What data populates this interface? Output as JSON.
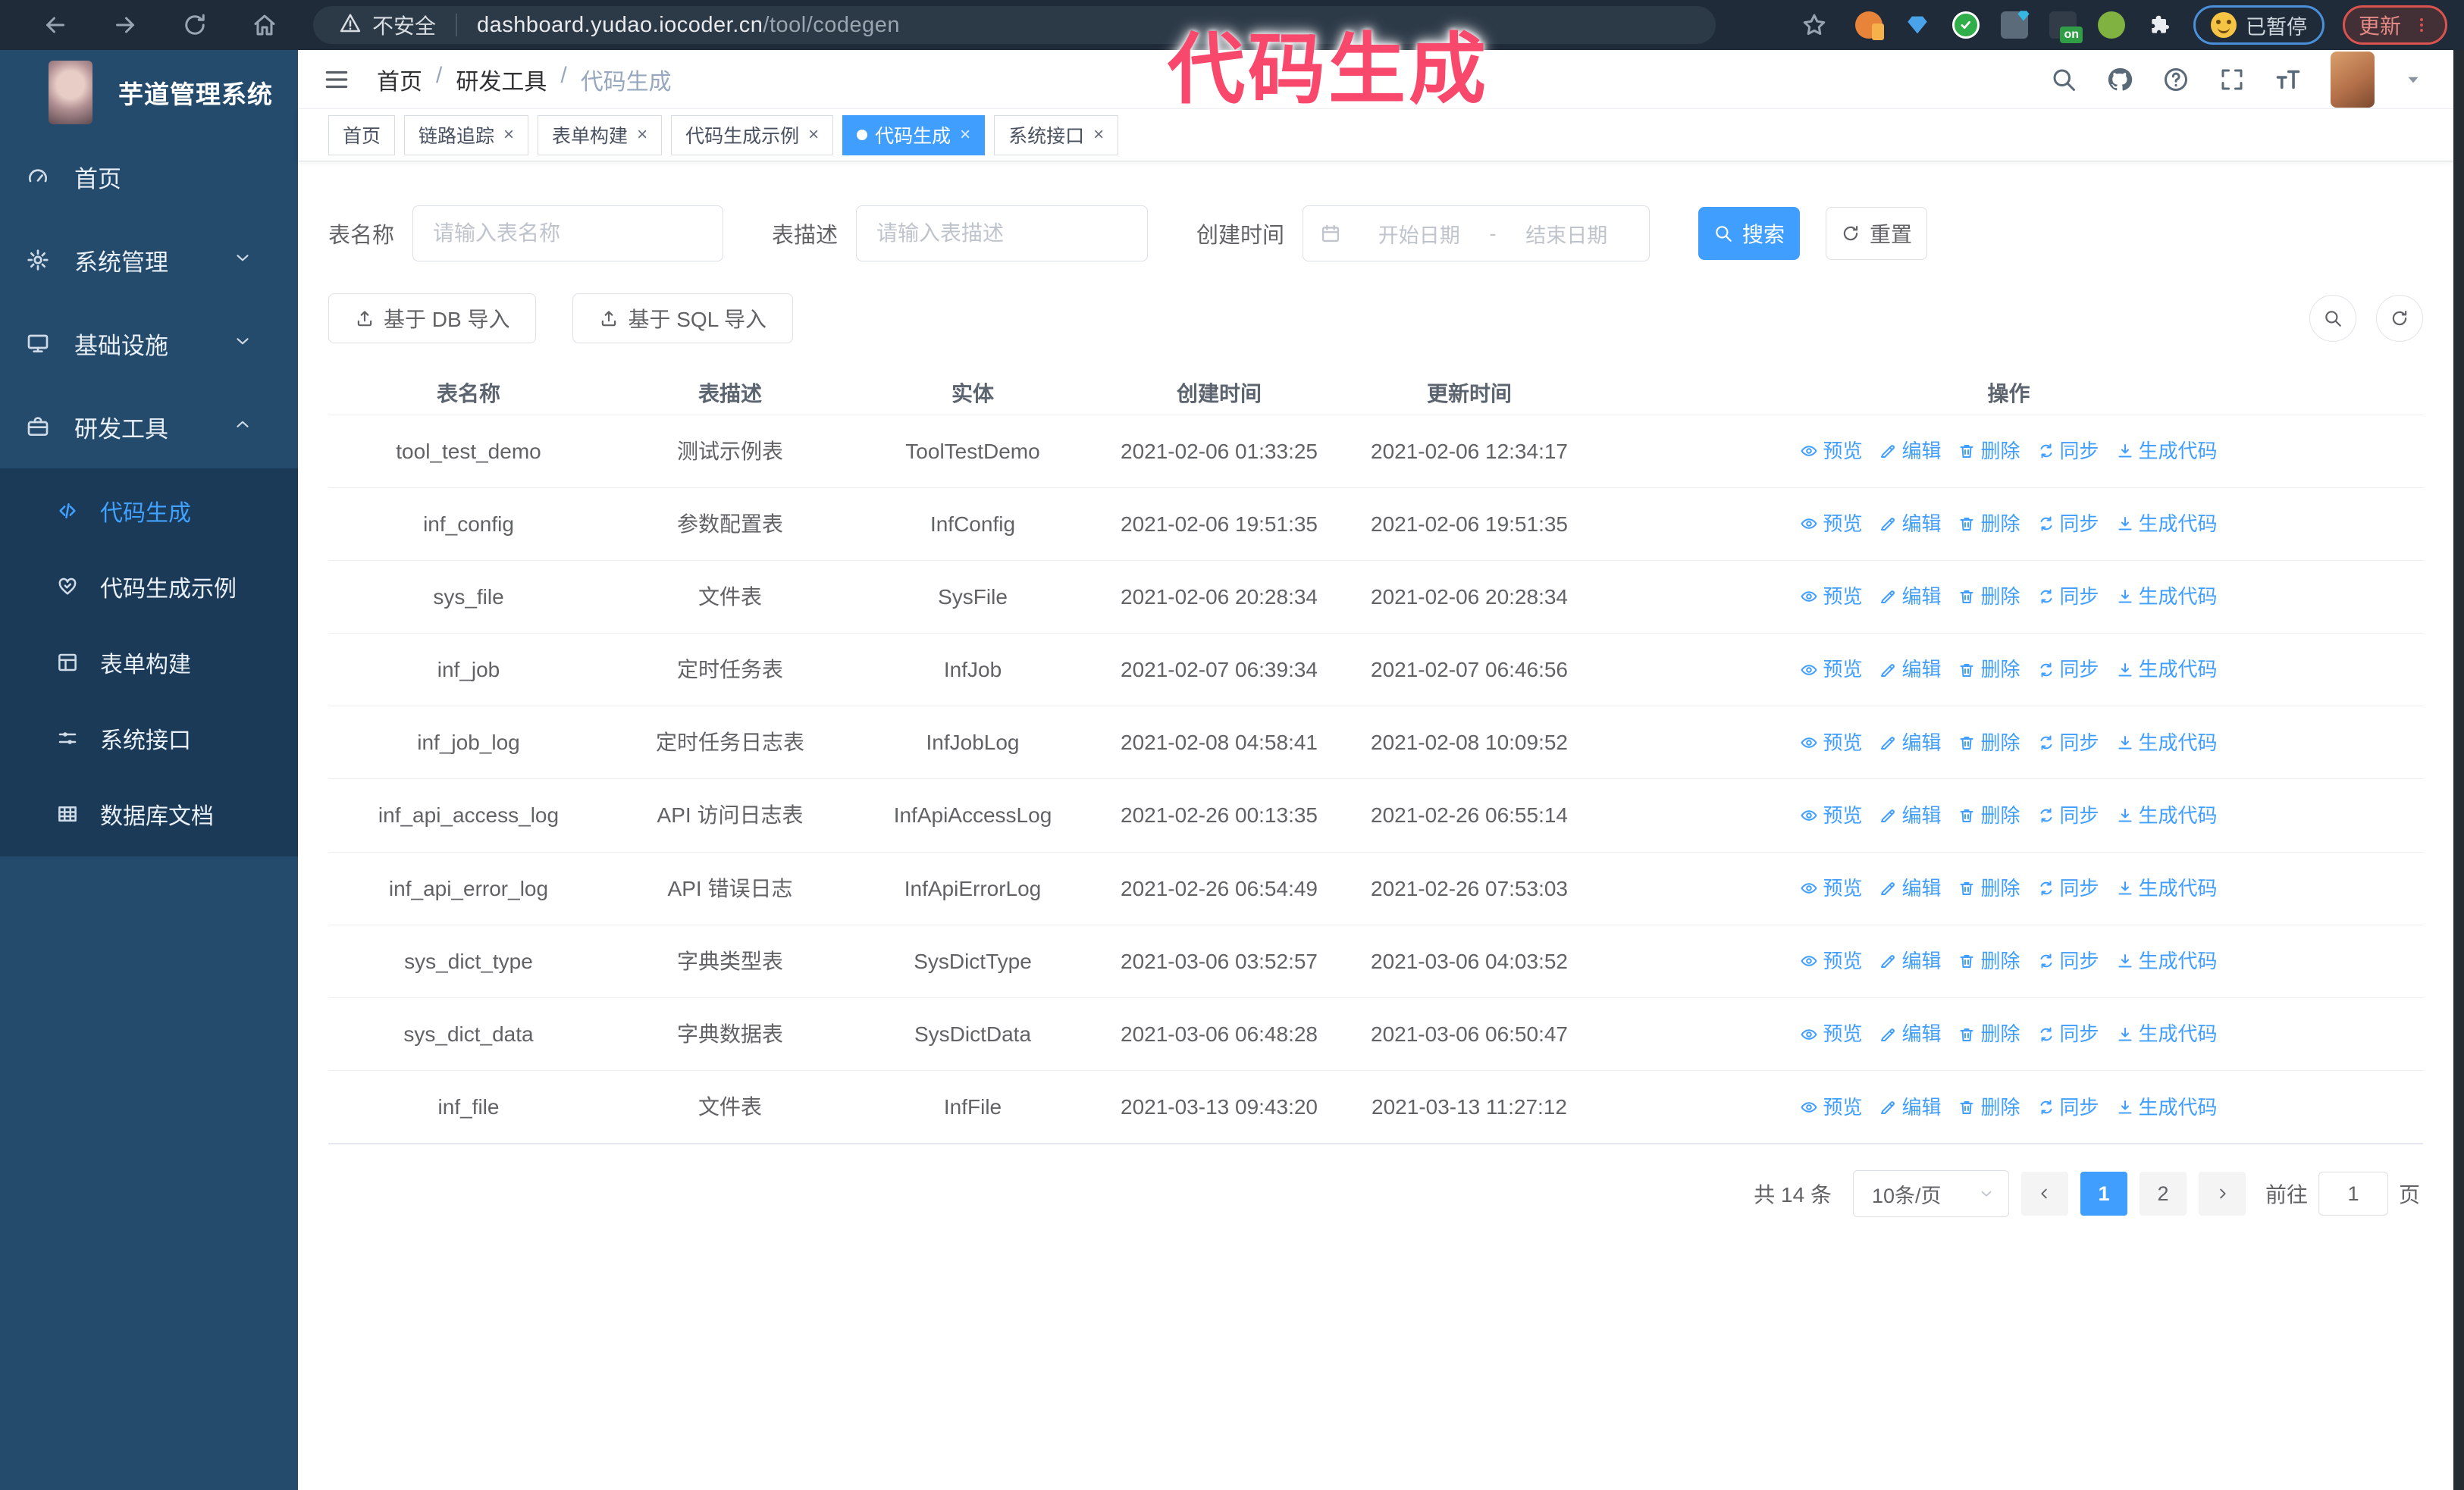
{
  "colors": {
    "accent": "#409eff",
    "overlay_pink": "#f8486c",
    "sidebar_bg": "#244a6c",
    "submenu_bg": "#1b3a58",
    "browser_bar": "#202b39"
  },
  "overlay_text": "代码生成",
  "browser": {
    "security_label": "不安全",
    "url_host": "dashboard.yudao.iocoder.cn",
    "url_path": "/tool/codegen",
    "ext_badge_on": "on",
    "paused_badge": "已暂停",
    "update_label": "更新"
  },
  "sidebar": {
    "logo_title": "芋道管理系统",
    "items": [
      {
        "label": "首页",
        "icon": "dashboard",
        "arrow": ""
      },
      {
        "label": "系统管理",
        "icon": "gear",
        "arrow": "down"
      },
      {
        "label": "基础设施",
        "icon": "monitor",
        "arrow": "down"
      },
      {
        "label": "研发工具",
        "icon": "tool",
        "arrow": "up",
        "open": true
      }
    ],
    "submenu": [
      {
        "label": "代码生成",
        "icon": "code",
        "active": true
      },
      {
        "label": "代码生成示例",
        "icon": "example",
        "active": false
      },
      {
        "label": "表单构建",
        "icon": "form",
        "active": false
      },
      {
        "label": "系统接口",
        "icon": "api",
        "active": false
      },
      {
        "label": "数据库文档",
        "icon": "db",
        "active": false
      }
    ]
  },
  "header": {
    "breadcrumb": [
      "首页",
      "研发工具",
      "代码生成"
    ],
    "separator": "/"
  },
  "tabs": [
    {
      "label": "首页",
      "closable": false,
      "active": false
    },
    {
      "label": "链路追踪",
      "closable": true,
      "active": false
    },
    {
      "label": "表单构建",
      "closable": true,
      "active": false
    },
    {
      "label": "代码生成示例",
      "closable": true,
      "active": false
    },
    {
      "label": "代码生成",
      "closable": true,
      "active": true
    },
    {
      "label": "系统接口",
      "closable": true,
      "active": false
    }
  ],
  "filters": {
    "name_label": "表名称",
    "name_placeholder": "请输入表名称",
    "desc_label": "表描述",
    "desc_placeholder": "请输入表描述",
    "time_label": "创建时间",
    "start_placeholder": "开始日期",
    "range_separator": "-",
    "end_placeholder": "结束日期",
    "search_label": "搜索",
    "reset_label": "重置"
  },
  "toolbar": {
    "import_db_label": "基于 DB 导入",
    "import_sql_label": "基于 SQL 导入"
  },
  "table": {
    "columns": [
      "表名称",
      "表描述",
      "实体",
      "创建时间",
      "更新时间",
      "操作"
    ],
    "action_labels": [
      "预览",
      "编辑",
      "删除",
      "同步",
      "生成代码"
    ],
    "action_icons": [
      "eye",
      "edit",
      "trash",
      "sync",
      "download"
    ],
    "rows": [
      {
        "name": "tool_test_demo",
        "desc": "测试示例表",
        "entity": "ToolTestDemo",
        "created": "2021-02-06 01:33:25",
        "updated": "2021-02-06 12:34:17",
        "created_two_line": false,
        "updated_two_line": false
      },
      {
        "name": "inf_config",
        "desc": "参数配置表",
        "entity": "InfConfig",
        "created": "2021-02-06 19:51:35",
        "updated": "2021-02-06 19:51:35",
        "created_two_line": false,
        "updated_two_line": false
      },
      {
        "name": "sys_file",
        "desc": "文件表",
        "entity": "SysFile",
        "created": "2021-02-06 20:28:34",
        "updated": "2021-02-06 20:28:34",
        "created_two_line": true,
        "updated_two_line": true
      },
      {
        "name": "inf_job",
        "desc": "定时任务表",
        "entity": "InfJob",
        "created": "2021-02-07 06:39:34",
        "updated": "2021-02-07 06:46:56",
        "created_two_line": true,
        "updated_two_line": true
      },
      {
        "name": "inf_job_log",
        "desc": "定时任务日志表",
        "entity": "InfJobLog",
        "created": "2021-02-08 04:58:41",
        "updated": "2021-02-08 10:09:52",
        "created_two_line": true,
        "updated_two_line": true
      },
      {
        "name": "inf_api_access_log",
        "desc": "API 访问日志表",
        "entity": "InfApiAccessLog",
        "created": "2021-02-26 00:13:35",
        "updated": "2021-02-26 06:55:14",
        "created_two_line": false,
        "updated_two_line": true
      },
      {
        "name": "inf_api_error_log",
        "desc": "API 错误日志",
        "entity": "InfApiErrorLog",
        "created": "2021-02-26 06:54:49",
        "updated": "2021-02-26 07:53:03",
        "created_two_line": true,
        "updated_two_line": true
      },
      {
        "name": "sys_dict_type",
        "desc": "字典类型表",
        "entity": "SysDictType",
        "created": "2021-03-06 03:52:57",
        "updated": "2021-03-06 04:03:52",
        "created_two_line": true,
        "updated_two_line": true
      },
      {
        "name": "sys_dict_data",
        "desc": "字典数据表",
        "entity": "SysDictData",
        "created": "2021-03-06 06:48:28",
        "updated": "2021-03-06 06:50:47",
        "created_two_line": true,
        "updated_two_line": true
      },
      {
        "name": "inf_file",
        "desc": "文件表",
        "entity": "InfFile",
        "created": "2021-03-13 09:43:20",
        "updated": "2021-03-13 11:27:12",
        "created_two_line": true,
        "updated_two_line": false
      }
    ]
  },
  "pagination": {
    "total": "共 14 条",
    "page_size": "10条/页",
    "pages": [
      "1",
      "2"
    ],
    "active_page": "1",
    "goto_label": "前往",
    "goto_value": "1",
    "unit_label": "页"
  }
}
